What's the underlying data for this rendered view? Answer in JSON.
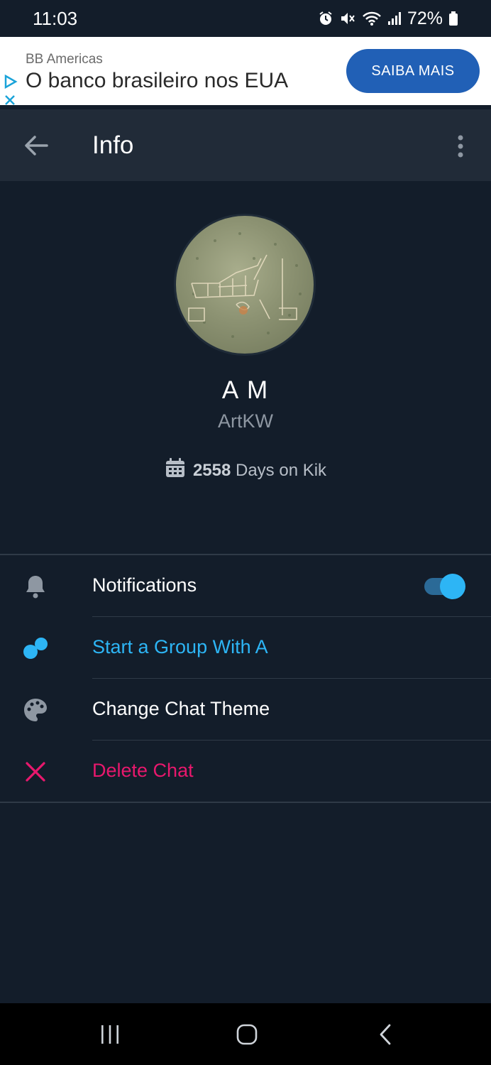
{
  "status_bar": {
    "time": "11:03",
    "battery": "72%"
  },
  "ad": {
    "brand": "BB Americas",
    "title": "O banco brasileiro nos EUA",
    "cta": "SAIBA MAIS"
  },
  "header": {
    "title": "Info"
  },
  "profile": {
    "display_name": "A M",
    "username": "ArtKW",
    "days_count": "2558",
    "days_text": "Days on Kik"
  },
  "menu": {
    "notifications": {
      "label": "Notifications",
      "enabled": true
    },
    "start_group": {
      "label": "Start a Group With A"
    },
    "change_theme": {
      "label": "Change Chat Theme"
    },
    "delete_chat": {
      "label": "Delete Chat"
    }
  },
  "colors": {
    "background": "#131d2a",
    "header": "#212b38",
    "accent_blue": "#2db5f5",
    "danger_pink": "#e8186d",
    "ad_button": "#2160b6"
  }
}
